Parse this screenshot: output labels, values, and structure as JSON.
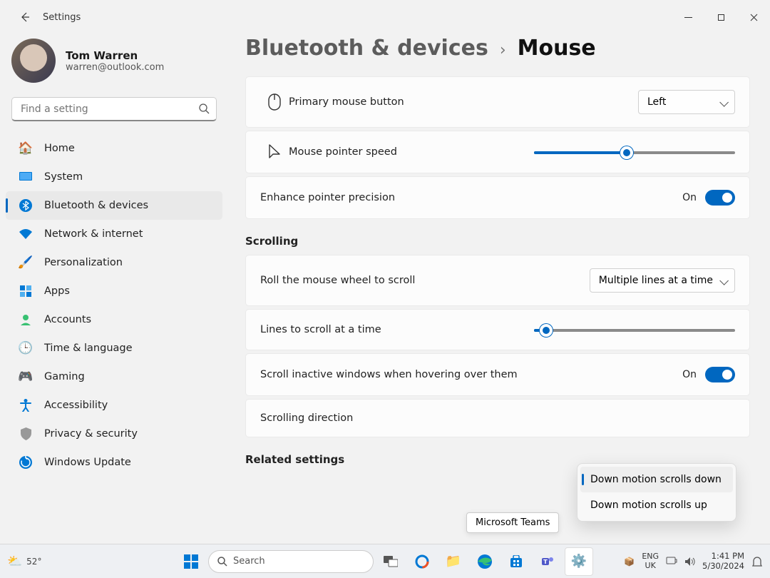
{
  "window": {
    "title": "Settings"
  },
  "user": {
    "name": "Tom Warren",
    "email": "warren@outlook.com"
  },
  "search": {
    "placeholder": "Find a setting"
  },
  "sidebar": {
    "items": [
      {
        "icon": "🏠",
        "label": "Home"
      },
      {
        "icon": "🖥️",
        "label": "System"
      },
      {
        "icon": "bt",
        "label": "Bluetooth & devices"
      },
      {
        "icon": "📶",
        "label": "Network & internet"
      },
      {
        "icon": "🖌️",
        "label": "Personalization"
      },
      {
        "icon": "🔲",
        "label": "Apps"
      },
      {
        "icon": "👤",
        "label": "Accounts"
      },
      {
        "icon": "🌐",
        "label": "Time & language"
      },
      {
        "icon": "🎮",
        "label": "Gaming"
      },
      {
        "icon": "♿",
        "label": "Accessibility"
      },
      {
        "icon": "🛡️",
        "label": "Privacy & security"
      },
      {
        "icon": "🔄",
        "label": "Windows Update"
      }
    ]
  },
  "breadcrumb": {
    "parent": "Bluetooth & devices",
    "current": "Mouse"
  },
  "settings": {
    "primary_button": {
      "label": "Primary mouse button",
      "value": "Left"
    },
    "pointer_speed": {
      "label": "Mouse pointer speed",
      "percent": 46
    },
    "enhance_precision": {
      "label": "Enhance pointer precision",
      "state": "On"
    },
    "scrolling_header": "Scrolling",
    "roll_wheel": {
      "label": "Roll the mouse wheel to scroll",
      "value": "Multiple lines at a time"
    },
    "lines_to_scroll": {
      "label": "Lines to scroll at a time",
      "percent": 6
    },
    "scroll_inactive": {
      "label": "Scroll inactive windows when hovering over them",
      "state": "On"
    },
    "scroll_direction": {
      "label": "Scrolling direction",
      "options": [
        "Down motion scrolls down",
        "Down motion scrolls up"
      ],
      "selected": 0
    },
    "related_header": "Related settings"
  },
  "tooltip": "Microsoft Teams",
  "taskbar": {
    "weather": {
      "temp": "52°"
    },
    "search": "Search",
    "lang": {
      "l1": "ENG",
      "l2": "UK"
    },
    "clock": {
      "time": "1:41 PM",
      "date": "5/30/2024"
    }
  }
}
